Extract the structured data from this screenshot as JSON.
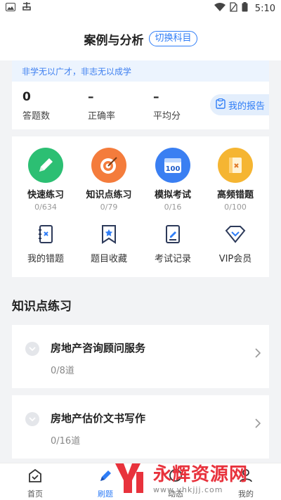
{
  "status_bar": {
    "time": "5:10"
  },
  "header": {
    "title": "案例与分析",
    "switch_label": "切换科目"
  },
  "top_card": {
    "motto": "非学无以广才，非志无以成学",
    "stats": [
      {
        "value": "0",
        "label": "答题数"
      },
      {
        "value": "–",
        "label": "正确率"
      },
      {
        "value": "–",
        "label": "平均分"
      }
    ],
    "report_label": "我的报告"
  },
  "practice_modes": [
    {
      "icon": "pencil-icon",
      "label": "快速练习",
      "count": "0/634",
      "color": "#2cbf73"
    },
    {
      "icon": "target-icon",
      "label": "知识点练习",
      "count": "0/79",
      "color": "#f47c3c"
    },
    {
      "icon": "calendar-100-icon",
      "label": "模拟考试",
      "count": "0/16",
      "color": "#3a7ff2"
    },
    {
      "icon": "wrong-book-icon",
      "label": "高频错题",
      "count": "0/100",
      "color": "#f5b532"
    }
  ],
  "tools": [
    {
      "icon": "wrong-notebook-icon",
      "label": "我的错题"
    },
    {
      "icon": "bookmark-star-icon",
      "label": "题目收藏"
    },
    {
      "icon": "exam-record-icon",
      "label": "考试记录"
    },
    {
      "icon": "vip-diamond-icon",
      "label": "VIP会员"
    }
  ],
  "section": {
    "title": "知识点练习",
    "items": [
      {
        "title": "房地产咨询顾问服务",
        "progress": "0/8道"
      },
      {
        "title": "房地产估价文书写作",
        "progress": "0/16道"
      }
    ]
  },
  "bottom_nav": [
    {
      "label": "首页",
      "active": false
    },
    {
      "label": "刷题",
      "active": true
    },
    {
      "label": "动态",
      "active": false
    },
    {
      "label": "我的",
      "active": false
    }
  ],
  "watermark": {
    "text": "永辉资源网",
    "url": "www.yhkjjj.com"
  },
  "colors": {
    "accent": "#2f7df6",
    "watermark": "#e8323c"
  }
}
